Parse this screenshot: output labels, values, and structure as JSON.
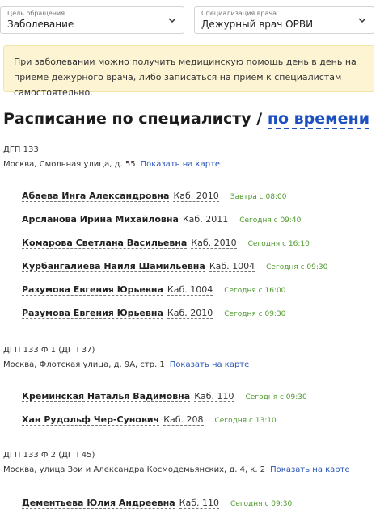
{
  "filters": {
    "reason": {
      "label": "Цель обращения",
      "value": "Заболевание"
    },
    "specialization": {
      "label": "Специализация врача",
      "value": "Дежурный врач ОРВИ"
    }
  },
  "notice": "При заболевании можно получить медицинскую помощь день в день на приеме дежурного врача, либо записаться на прием к специалистам самостоятельно.",
  "heading": {
    "title": "Расписание по специалисту /",
    "link": "по времени"
  },
  "map_link": "Показать на карте",
  "clinics": [
    {
      "name": "ДГП 133",
      "address": "Москва, Смольная улица, д. 55",
      "doctors": [
        {
          "name": "Абаева Инга Александровна",
          "room": "Каб. 2010",
          "time": "Завтра с 08:00"
        },
        {
          "name": "Арсланова Ирина Михайловна",
          "room": "Каб. 2011",
          "time": "Сегодня с 09:40"
        },
        {
          "name": "Комарова Светлана Васильевна",
          "room": "Каб. 2010",
          "time": "Сегодня с 16:10"
        },
        {
          "name": "Курбангалиева Наиля Шамильевна",
          "room": "Каб. 1004",
          "time": "Сегодня с 09:30"
        },
        {
          "name": "Разумова Евгения Юрьевна",
          "room": "Каб. 1004",
          "time": "Сегодня с 16:00"
        },
        {
          "name": "Разумова Евгения Юрьевна",
          "room": "Каб. 2010",
          "time": "Сегодня с 09:30"
        }
      ]
    },
    {
      "name": "ДГП 133 Ф 1 (ДГП 37)",
      "address": "Москва, Флотская улица, д. 9А, стр. 1",
      "doctors": [
        {
          "name": "Креминская Наталья Вадимовна",
          "room": "Каб. 110",
          "time": "Сегодня с 09:30"
        },
        {
          "name": "Хан Рудольф Чер-Сунович",
          "room": "Каб. 208",
          "time": "Сегодня с 13:10"
        }
      ]
    },
    {
      "name": "ДГП 133 Ф 2 (ДГП 45)",
      "address": "Москва, улица Зои и Александра Космодемьянских, д. 4, к. 2",
      "doctors": [
        {
          "name": "Дементьева Юлия Андреевна",
          "room": "Каб. 110",
          "time": "Сегодня с 09:30"
        }
      ]
    }
  ],
  "colors": {
    "link": "#1c4fc0",
    "time": "#4f9a2e",
    "notice_bg": "#fcf4d2"
  }
}
